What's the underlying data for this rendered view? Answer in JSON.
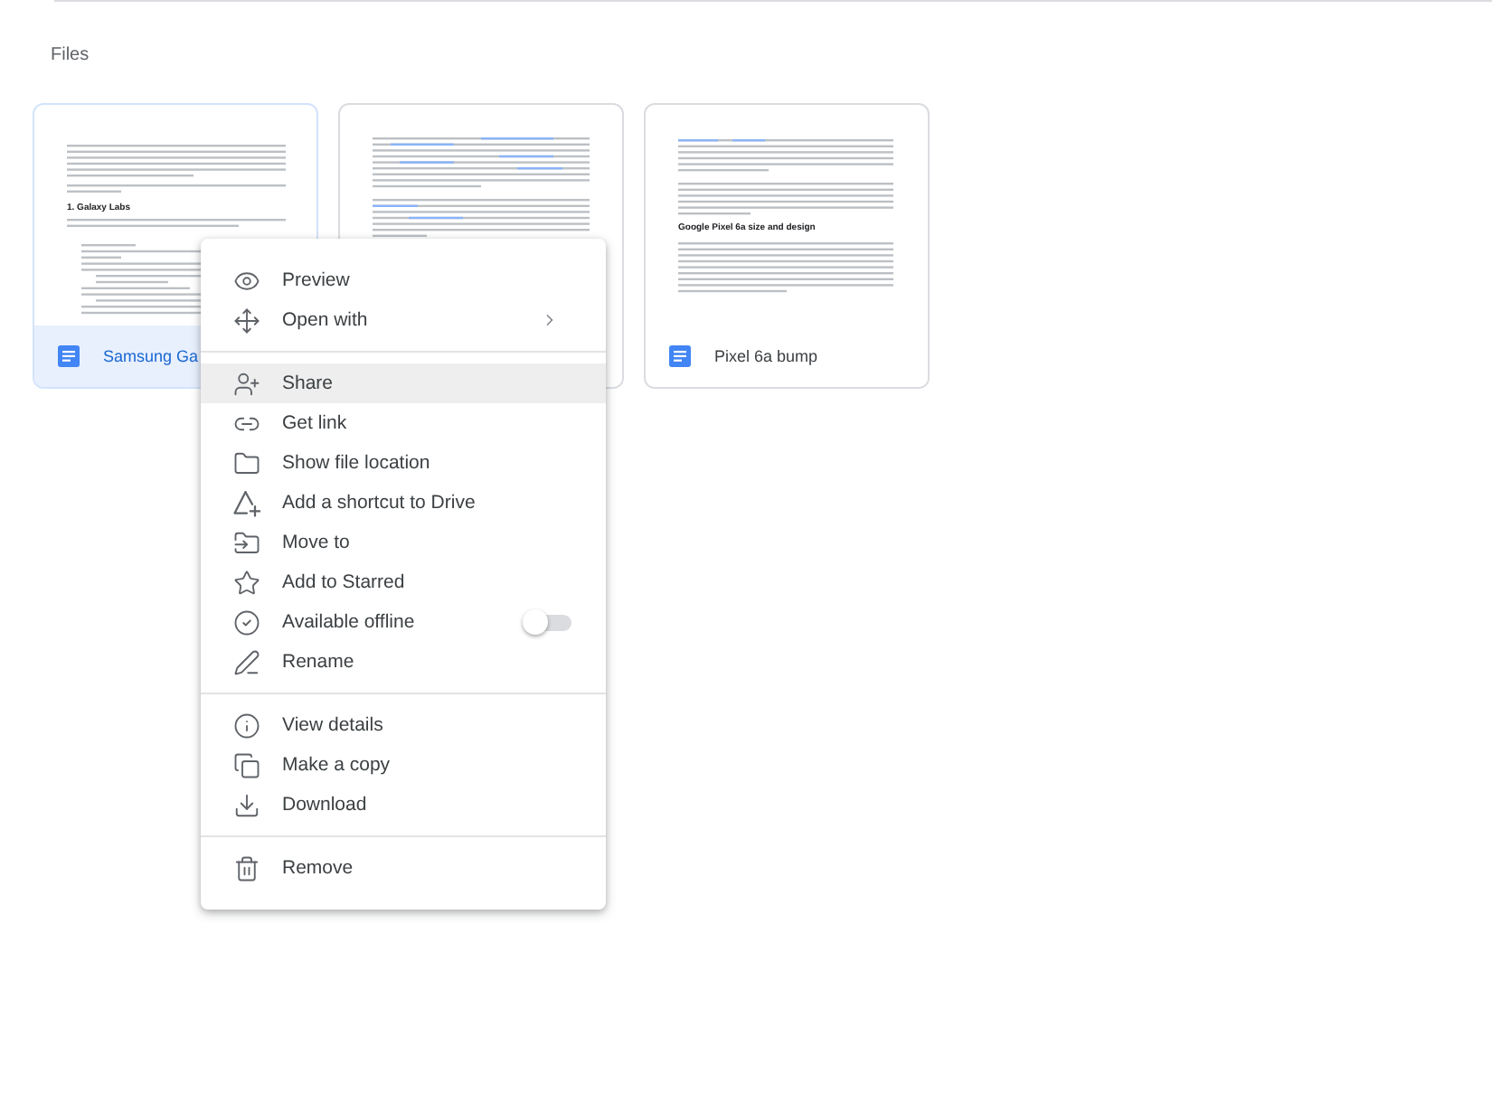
{
  "section_title": "Files",
  "files": [
    {
      "name": "Samsung Ga",
      "selected": true,
      "thumbnail_heading": "1. Galaxy Labs"
    },
    {
      "selected": false
    },
    {
      "name": "Pixel 6a bump",
      "selected": false,
      "thumbnail_heading": "Google Pixel 6a size and design"
    }
  ],
  "context_menu": {
    "groups": [
      {
        "items": [
          {
            "label": "Preview",
            "kind": "action",
            "highlighted": false
          },
          {
            "label": "Open with",
            "kind": "submenu",
            "highlighted": false
          }
        ]
      },
      {
        "items": [
          {
            "label": "Share",
            "kind": "action",
            "highlighted": true
          },
          {
            "label": "Get link",
            "kind": "action",
            "highlighted": false
          },
          {
            "label": "Show file location",
            "kind": "action",
            "highlighted": false
          },
          {
            "label": "Add a shortcut to Drive",
            "kind": "action",
            "highlighted": false
          },
          {
            "label": "Move to",
            "kind": "action",
            "highlighted": false
          },
          {
            "label": "Add to Starred",
            "kind": "action",
            "highlighted": false
          },
          {
            "label": "Available offline",
            "kind": "toggle",
            "on": false,
            "highlighted": false
          },
          {
            "label": "Rename",
            "kind": "action",
            "highlighted": false
          }
        ]
      },
      {
        "items": [
          {
            "label": "View details",
            "kind": "action",
            "highlighted": false
          },
          {
            "label": "Make a copy",
            "kind": "action",
            "highlighted": false
          },
          {
            "label": "Download",
            "kind": "action",
            "highlighted": false
          }
        ]
      },
      {
        "items": [
          {
            "label": "Remove",
            "kind": "action",
            "highlighted": false
          }
        ]
      }
    ]
  }
}
